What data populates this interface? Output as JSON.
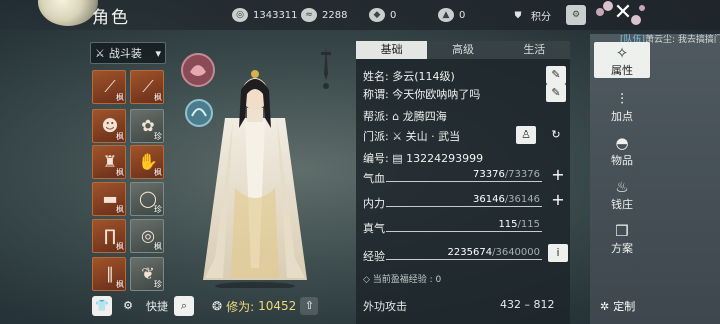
{
  "header": {
    "title": "角色",
    "resources": [
      {
        "icon": "coin-icon",
        "value": "1343311"
      },
      {
        "icon": "silver-icon",
        "value": "2288"
      },
      {
        "icon": "jade-icon",
        "value": "0"
      },
      {
        "icon": "ingot-icon",
        "value": "0"
      }
    ],
    "points_label": "积分"
  },
  "chat_tip": {
    "tag": "[队伍]",
    "text": "萧云尘: 我去搞搞门"
  },
  "equipment": {
    "dropdown_label": "战斗装",
    "slots": [
      {
        "tag": "枫"
      },
      {
        "tag": "枫"
      },
      {
        "tag": "枫"
      },
      {
        "tag": "珍"
      },
      {
        "tag": "枫"
      },
      {
        "tag": "枫"
      },
      {
        "tag": "枫"
      },
      {
        "tag": "珍"
      },
      {
        "tag": "枫"
      },
      {
        "tag": "枫"
      },
      {
        "tag": "枫"
      },
      {
        "tag": "珍"
      }
    ],
    "quick_label": "快捷",
    "power_label": "修为:",
    "power_value": "10452"
  },
  "tabs": [
    "基础",
    "高级",
    "生活"
  ],
  "info": {
    "name_label": "姓名:",
    "name_value": "多云(114级)",
    "title_label": "称谓:",
    "title_value": "今天你欧呐呐了吗",
    "guild_label": "帮派:",
    "guild_value": "龙腾四海",
    "school_label": "门派:",
    "school_value": "关山 · 武当",
    "id_label": "编号:",
    "id_value": "13224293999"
  },
  "stats": [
    {
      "label": "气血",
      "cur": "73376",
      "max": "/73376",
      "btn": "+"
    },
    {
      "label": "内力",
      "cur": "36146",
      "max": "/36146",
      "btn": "+"
    },
    {
      "label": "真气",
      "cur": "115",
      "max": "/115",
      "btn": ""
    },
    {
      "label": "经验",
      "cur": "2235674",
      "max": "/3640000",
      "btn": "i"
    }
  ],
  "bonus_exp": "当前盈福经验 : 0",
  "footer": {
    "label": "外功攻击",
    "value": "432 – 812"
  },
  "nav": [
    "属性",
    "加点",
    "物品",
    "钱庄",
    "方案"
  ],
  "customize_label": "定制"
}
